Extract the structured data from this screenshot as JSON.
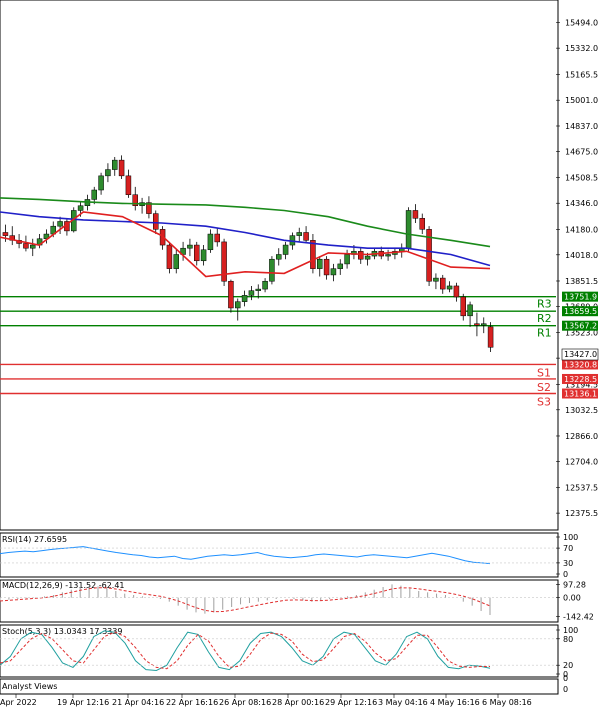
{
  "chart_data": [
    {
      "type": "candlestick",
      "title": "",
      "ylim": [
        12300,
        15600
      ],
      "y_ticks": [
        "15494.0",
        "15332.0",
        "15165.5",
        "15001.0",
        "14837.0",
        "14675.0",
        "14508.5",
        "14346.0",
        "14180.0",
        "14018.0",
        "13851.5",
        "13689.0",
        "13523.0",
        "13361.0",
        "13194.5",
        "13032.5",
        "12866.0",
        "12704.0",
        "12537.5",
        "12375.5"
      ],
      "x_ticks": [
        "Apr 2022",
        "19 Apr 12:16",
        "21 Apr 04:16",
        "22 Apr 16:16",
        "26 Apr 08:16",
        "28 Apr 00:16",
        "29 Apr 12:16",
        "3 May 04:16",
        "4 May 16:16",
        "6 May 08:16"
      ],
      "current_price": "13427.0",
      "levels": [
        {
          "name": "R3",
          "value": 13751.9,
          "label": "13751.9",
          "color": "#008000"
        },
        {
          "name": "R2",
          "value": 13659.5,
          "label": "13659.5",
          "color": "#008000"
        },
        {
          "name": "R1",
          "value": 13567.2,
          "label": "13567.2",
          "color": "#008000"
        },
        {
          "name": "S1",
          "value": 13320.8,
          "label": "13320.8",
          "color": "#e03030"
        },
        {
          "name": "S2",
          "value": 13228.5,
          "label": "13228.5",
          "color": "#e03030"
        },
        {
          "name": "S3",
          "value": 13136.1,
          "label": "13136.1",
          "color": "#e03030"
        }
      ],
      "candles": [
        [
          14160,
          14210,
          14100,
          14140
        ],
        [
          14140,
          14200,
          14080,
          14110
        ],
        [
          14110,
          14150,
          14060,
          14090
        ],
        [
          14090,
          14140,
          14040,
          14060
        ],
        [
          14060,
          14120,
          14010,
          14080
        ],
        [
          14080,
          14150,
          14060,
          14120
        ],
        [
          14120,
          14180,
          14090,
          14150
        ],
        [
          14150,
          14230,
          14130,
          14200
        ],
        [
          14200,
          14260,
          14150,
          14230
        ],
        [
          14230,
          14250,
          14140,
          14170
        ],
        [
          14170,
          14320,
          14160,
          14300
        ],
        [
          14300,
          14360,
          14260,
          14330
        ],
        [
          14330,
          14400,
          14300,
          14370
        ],
        [
          14370,
          14450,
          14340,
          14430
        ],
        [
          14430,
          14540,
          14400,
          14520
        ],
        [
          14520,
          14600,
          14480,
          14560
        ],
        [
          14560,
          14640,
          14520,
          14620
        ],
        [
          14620,
          14650,
          14500,
          14520
        ],
        [
          14520,
          14560,
          14380,
          14400
        ],
        [
          14400,
          14450,
          14300,
          14330
        ],
        [
          14330,
          14380,
          14280,
          14350
        ],
        [
          14350,
          14390,
          14250,
          14280
        ],
        [
          14280,
          14300,
          14150,
          14180
        ],
        [
          14180,
          14200,
          14050,
          14080
        ],
        [
          14080,
          14100,
          13900,
          13930
        ],
        [
          13930,
          14050,
          13900,
          14020
        ],
        [
          14020,
          14100,
          13980,
          14060
        ],
        [
          14060,
          14120,
          14010,
          14080
        ],
        [
          14080,
          14100,
          13950,
          13980
        ],
        [
          13980,
          14080,
          13950,
          14050
        ],
        [
          14050,
          14180,
          14030,
          14150
        ],
        [
          14150,
          14190,
          14070,
          14100
        ],
        [
          14100,
          14120,
          13820,
          13850
        ],
        [
          13850,
          13860,
          13650,
          13680
        ],
        [
          13680,
          13740,
          13600,
          13720
        ],
        [
          13720,
          13790,
          13690,
          13760
        ],
        [
          13760,
          13820,
          13730,
          13790
        ],
        [
          13790,
          13830,
          13740,
          13800
        ],
        [
          13800,
          13870,
          13780,
          13850
        ],
        [
          13850,
          14010,
          13830,
          13990
        ],
        [
          13990,
          14060,
          13950,
          14020
        ],
        [
          14020,
          14100,
          13990,
          14080
        ],
        [
          14080,
          14160,
          14050,
          14140
        ],
        [
          14140,
          14190,
          14100,
          14160
        ],
        [
          14160,
          14200,
          14090,
          14110
        ],
        [
          14110,
          14150,
          13900,
          13930
        ],
        [
          13930,
          14010,
          13880,
          13990
        ],
        [
          13990,
          14010,
          13860,
          13890
        ],
        [
          13890,
          13960,
          13850,
          13930
        ],
        [
          13930,
          13990,
          13890,
          13960
        ],
        [
          13960,
          14050,
          13930,
          14020
        ],
        [
          14020,
          14080,
          13990,
          14040
        ],
        [
          14040,
          14060,
          13960,
          13990
        ],
        [
          13990,
          14030,
          13950,
          14010
        ],
        [
          14010,
          14060,
          13990,
          14040
        ],
        [
          14040,
          14070,
          13990,
          14010
        ],
        [
          14010,
          14050,
          13980,
          14020
        ],
        [
          14020,
          14060,
          13990,
          14040
        ],
        [
          14040,
          14090,
          14000,
          14060
        ],
        [
          14060,
          14320,
          14040,
          14300
        ],
        [
          14300,
          14340,
          14220,
          14250
        ],
        [
          14250,
          14280,
          14150,
          14180
        ],
        [
          14180,
          14200,
          13820,
          13850
        ],
        [
          13850,
          13900,
          13800,
          13870
        ],
        [
          13870,
          13890,
          13770,
          13800
        ],
        [
          13800,
          13850,
          13780,
          13820
        ],
        [
          13820,
          13840,
          13720,
          13750
        ],
        [
          13750,
          13770,
          13600,
          13630
        ],
        [
          13630,
          13720,
          13560,
          13700
        ],
        [
          13580,
          13650,
          13500,
          13570
        ],
        [
          13570,
          13620,
          13520,
          13580
        ],
        [
          13560,
          13590,
          13400,
          13430
        ]
      ],
      "ma_green": [
        14380,
        14370,
        14355,
        14345,
        14340,
        14335,
        14320,
        14300,
        14260,
        14200,
        14150,
        14110,
        14070
      ],
      "ma_blue": [
        14290,
        14260,
        14240,
        14230,
        14220,
        14200,
        14160,
        14110,
        14080,
        14060,
        14060,
        14020,
        13950
      ],
      "ma_red": [
        14130,
        14080,
        14290,
        14260,
        14140,
        13880,
        13910,
        13900,
        14030,
        14020,
        14040,
        13940,
        13930
      ],
      "ma_x_fraction": [
        0,
        0.08,
        0.17,
        0.25,
        0.33,
        0.42,
        0.5,
        0.58,
        0.67,
        0.75,
        0.83,
        0.92,
        1
      ]
    },
    {
      "type": "line",
      "title": "RSI(14) 27.6595",
      "ylim": [
        0,
        100
      ],
      "y_ticks": [
        "100",
        "70",
        "30",
        "0"
      ],
      "series": [
        {
          "name": "RSI",
          "color": "#1e90ff",
          "values": [
            55,
            58,
            60,
            62,
            60,
            63,
            66,
            68,
            70,
            72,
            74,
            70,
            66,
            62,
            58,
            55,
            52,
            50,
            46,
            44,
            46,
            48,
            42,
            40,
            44,
            48,
            50,
            52,
            50,
            52,
            55,
            58,
            52,
            48,
            46,
            44,
            46,
            48,
            52,
            54,
            52,
            50,
            48,
            46,
            50,
            52,
            50,
            48,
            46,
            44,
            48,
            52,
            56,
            52,
            48,
            42,
            36,
            32,
            30,
            28
          ]
        }
      ]
    },
    {
      "type": "bar",
      "title": "MACD(12,26,9) -131.52 -62.41",
      "ylim": [
        -160,
        110
      ],
      "y_ticks": [
        "97.28",
        "0.00",
        "-142.42"
      ],
      "series": [
        {
          "name": "MACD",
          "color": "#a0a0a0",
          "values": [
            -20,
            -15,
            -10,
            -5,
            0,
            10,
            20,
            40,
            60,
            80,
            90,
            85,
            70,
            50,
            30,
            20,
            10,
            0,
            -10,
            -30,
            -60,
            -90,
            -110,
            -120,
            -110,
            -90,
            -70,
            -50,
            -40,
            -30,
            -20,
            -10,
            0,
            -10,
            -20,
            -30,
            -20,
            -10,
            0,
            10,
            20,
            40,
            60,
            80,
            100,
            90,
            70,
            50,
            40,
            30,
            20,
            0,
            -30,
            -60,
            -100,
            -130
          ]
        },
        {
          "name": "Signal",
          "color": "#e03030",
          "values": [
            -25,
            -20,
            -15,
            -10,
            -5,
            0,
            10,
            25,
            40,
            55,
            68,
            75,
            73,
            65,
            52,
            40,
            30,
            20,
            10,
            -5,
            -25,
            -50,
            -75,
            -95,
            -105,
            -104,
            -95,
            -82,
            -68,
            -55,
            -42,
            -30,
            -20,
            -17,
            -18,
            -22,
            -22,
            -18,
            -12,
            -5,
            4,
            16,
            31,
            48,
            66,
            74,
            73,
            66,
            57,
            48,
            39,
            27,
            12,
            -8,
            -35,
            -62
          ]
        }
      ]
    },
    {
      "type": "line",
      "title": "Stoch(5,3,3) 13.0343 17.3339",
      "ylim": [
        0,
        100
      ],
      "y_ticks": [
        "100",
        "80",
        "20",
        "0"
      ],
      "series": [
        {
          "name": "%K",
          "color": "#20a0a0",
          "values": [
            20,
            40,
            80,
            95,
            90,
            60,
            25,
            15,
            40,
            85,
            98,
            95,
            70,
            30,
            10,
            8,
            20,
            60,
            95,
            90,
            50,
            15,
            10,
            30,
            70,
            92,
            95,
            85,
            60,
            30,
            20,
            40,
            80,
            95,
            90,
            60,
            30,
            20,
            45,
            85,
            95,
            80,
            40,
            15,
            12,
            20,
            18,
            13
          ]
        },
        {
          "name": "%D",
          "color": "#e03030",
          "values": [
            25,
            30,
            55,
            80,
            92,
            80,
            55,
            30,
            25,
            55,
            85,
            95,
            85,
            60,
            30,
            15,
            12,
            30,
            65,
            90,
            75,
            40,
            15,
            18,
            45,
            78,
            93,
            90,
            75,
            45,
            28,
            32,
            58,
            85,
            92,
            75,
            48,
            30,
            35,
            62,
            88,
            88,
            60,
            30,
            18,
            15,
            17,
            17
          ]
        }
      ]
    }
  ],
  "footer": {
    "left_label": "Analyst Views"
  }
}
